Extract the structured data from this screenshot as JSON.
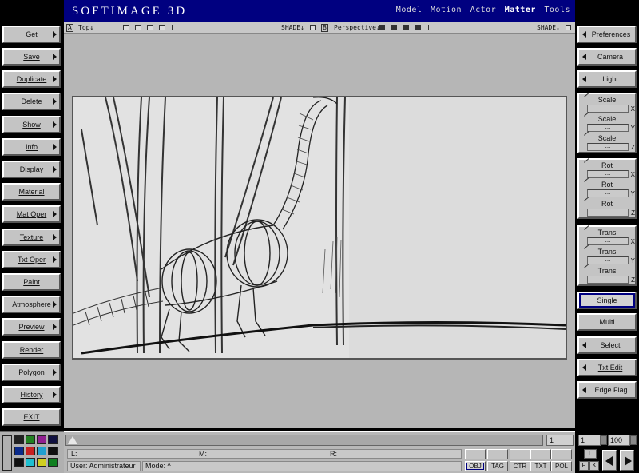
{
  "app": {
    "logo_left": "SOFTIMAGE",
    "logo_right": "3D"
  },
  "modes": [
    {
      "label": "Model",
      "active": false
    },
    {
      "label": "Motion",
      "active": false
    },
    {
      "label": "Actor",
      "active": false
    },
    {
      "label": "Matter",
      "active": true
    },
    {
      "label": "Tools",
      "active": false
    }
  ],
  "left_menu": [
    "Get",
    "Save",
    "Duplicate",
    "Delete",
    "Show",
    "Info",
    "Display",
    "Material",
    "Mat Oper",
    "Texture",
    "Txt Oper",
    "Paint",
    "Atmosphere",
    "Preview",
    "Render",
    "Polygon",
    "History",
    "EXIT"
  ],
  "right_menu": {
    "preferences": "Preferences",
    "camera": "Camera",
    "light": "Light"
  },
  "transform": {
    "scale": {
      "label": "Scale",
      "axes": [
        "X",
        "Y",
        "Z"
      ]
    },
    "rot": {
      "label": "Rot",
      "axes": [
        "X",
        "Y",
        "Z"
      ]
    },
    "trans": {
      "label": "Trans",
      "axes": [
        "X",
        "Y",
        "Z"
      ]
    },
    "dots": "..."
  },
  "selection": {
    "single": "Single",
    "multi": "Multi",
    "select": "Select",
    "txt_edit": "Txt Edit",
    "edge_flag": "Edge Flag"
  },
  "viewport": {
    "box_a": "A",
    "box_b": "B",
    "top_label": "Top↓",
    "shade1": "SHADE↓",
    "persp_label": "Perspective↓",
    "shade2": "SHADE↓"
  },
  "status": {
    "frame": "1",
    "l_label": "L:",
    "m_label": "M:",
    "r_label": "R:",
    "user": "User: Administrateur",
    "mode": "Mode:      ^",
    "buttons": [
      "OBJ",
      "TAG",
      "CTR",
      "TXT",
      "POL"
    ]
  },
  "frames": {
    "start": "1",
    "end": "100",
    "l": "L",
    "f": "F",
    "k": "K"
  },
  "palette_colors": [
    "#202020",
    "#208020",
    "#902090",
    "#101040",
    "#0a2a8a",
    "#c82020",
    "#20a0d0",
    "#101010",
    "#101010",
    "#20c0d0",
    "#d0d020",
    "#108020"
  ],
  "colors": {
    "titlebar": "#000080",
    "panel": "#c4c4c4"
  }
}
